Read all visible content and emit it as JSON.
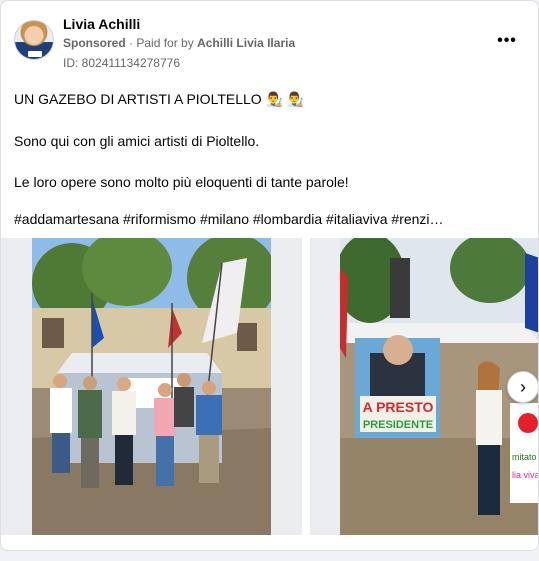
{
  "post": {
    "author": "Livia Achilli",
    "sponsored_label": "Sponsored",
    "paid_for_prefix": "Paid for by",
    "paid_for_name": "Achilli Livia Ilaria",
    "separator": "·",
    "id_text": "ID: 802411134278776",
    "more_icon": "•••",
    "lines": [
      "UN GAZEBO DI ARTISTI A PIOLTELLO",
      "Sono qui con gli amici artisti di Pioltello.",
      "Le loro opere sono molto più eloquenti di tante parole!",
      "#addamartesana #riformismo #milano #lombardia #italiaviva #renzi…"
    ],
    "emojis": "👨‍🎨 👨‍🎨"
  },
  "photos": {
    "photo2_sign_line1": "A PRESTO",
    "photo2_sign_line2": "PRESIDENTE",
    "photo2_side_text1": "mitato",
    "photo2_side_text2": "lia viva"
  },
  "gallery": {
    "next_icon": "›"
  },
  "colors": {
    "text": "#050505",
    "secondary": "#65676b",
    "card_bg": "#ffffff",
    "page_bg": "#f0f2f5"
  }
}
